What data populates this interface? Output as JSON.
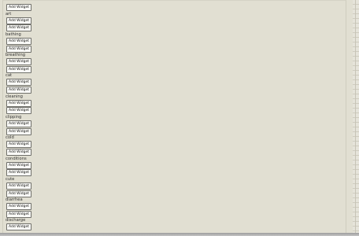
{
  "button_label": "Add Widget",
  "sections": [
    {
      "label": "",
      "buttons": [
        "Add Widget"
      ]
    },
    {
      "label": "art",
      "buttons": [
        "Add Widget",
        "Add Widget"
      ]
    },
    {
      "label": "bathing",
      "buttons": [
        "Add Widget",
        "Add Widget"
      ]
    },
    {
      "label": "breathing",
      "buttons": [
        "Add Widget",
        "Add Widget"
      ]
    },
    {
      "label": "cat",
      "buttons": [
        "Add Widget",
        "Add Widget"
      ]
    },
    {
      "label": "cleaning",
      "buttons": [
        "Add Widget",
        "Add Widget"
      ]
    },
    {
      "label": "clipping",
      "buttons": [
        "Add Widget",
        "Add Widget"
      ]
    },
    {
      "label": "cold",
      "buttons": [
        "Add Widget",
        "Add Widget"
      ]
    },
    {
      "label": "conditions",
      "buttons": [
        "Add Widget",
        "Add Widget"
      ]
    },
    {
      "label": "cute",
      "buttons": [
        "Add Widget",
        "Add Widget"
      ]
    },
    {
      "label": "diarrhea",
      "buttons": [
        "Add Widget",
        "Add Widget"
      ]
    },
    {
      "label": "discharge",
      "buttons": [
        "Add Widget"
      ]
    }
  ],
  "colors": {
    "background": "#e1dfd2",
    "button_face": "#fbfbf8",
    "button_border": "#6f6f6a",
    "label_text": "#333333"
  }
}
